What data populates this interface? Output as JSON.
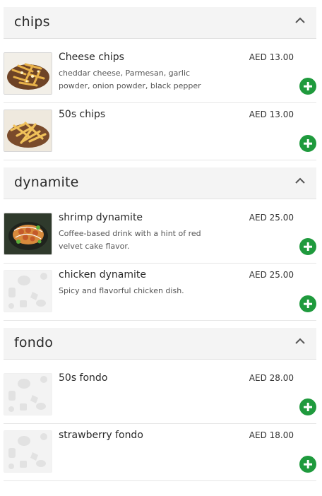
{
  "categories": [
    {
      "title": "chips",
      "items": [
        {
          "name": "Cheese chips",
          "description": "cheddar cheese, Parmesan, garlic powder, onion powder, black pepper",
          "price": "AED 13.00",
          "image": "cheese-chips-photo"
        },
        {
          "name": "50s chips",
          "description": "",
          "price": "AED 13.00",
          "image": "fries-photo"
        }
      ]
    },
    {
      "title": "dynamite",
      "items": [
        {
          "name": "shrimp dynamite",
          "description": "Coffee-based drink with a hint of red velvet cake flavor.",
          "price": "AED 25.00",
          "image": "shrimp-dynamite-photo"
        },
        {
          "name": "chicken dynamite",
          "description": "Spicy and flavorful chicken dish.",
          "price": "AED 25.00",
          "image": "placeholder-pattern"
        }
      ]
    },
    {
      "title": "fondo",
      "items": [
        {
          "name": "50s fondo",
          "description": "",
          "price": "AED 28.00",
          "image": "placeholder-pattern"
        },
        {
          "name": "strawberry fondo",
          "description": "",
          "price": "AED 18.00",
          "image": "placeholder-pattern"
        }
      ]
    }
  ],
  "colors": {
    "add_button": "#1f9a3d",
    "header_bg": "#f4f4f4"
  },
  "icons": {
    "collapse": "chevron-up-icon",
    "add": "plus-icon"
  }
}
